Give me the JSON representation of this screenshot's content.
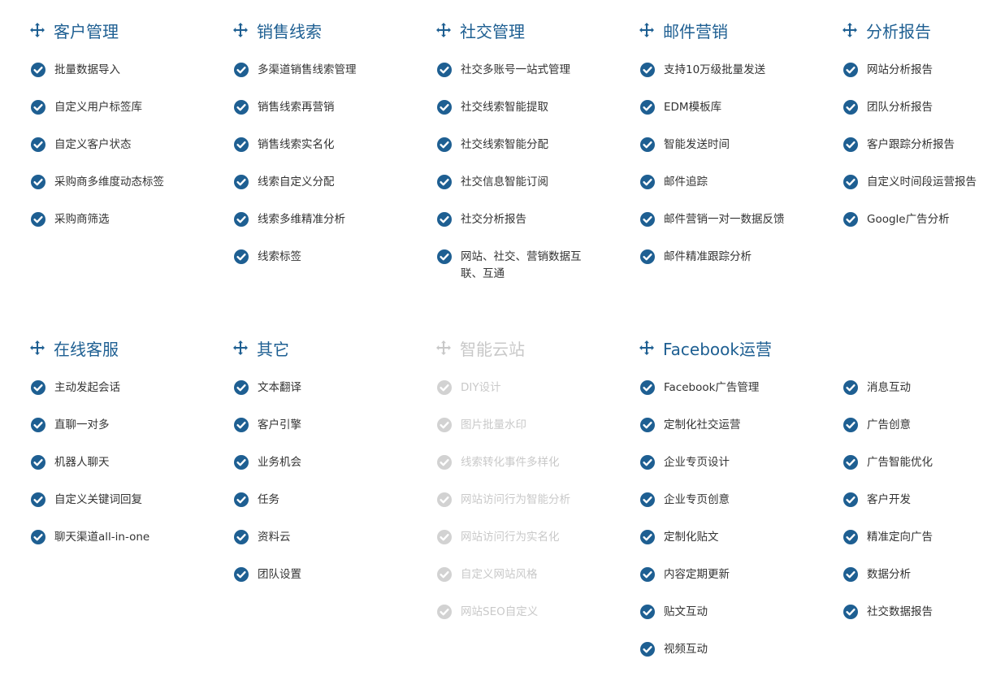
{
  "colors": {
    "accent": "#1e5f92",
    "text": "#333333",
    "muted": "#c8c8c8"
  },
  "rows": [
    {
      "columns": [
        {
          "title": "客户管理",
          "items": [
            "批量数据导入",
            "自定义用户标签库",
            "自定义客户状态",
            "采购商多维度动态标签",
            "采购商筛选"
          ]
        },
        {
          "title": "销售线索",
          "items": [
            "多渠道销售线索管理",
            "销售线索再营销",
            "销售线索实名化",
            "线索自定义分配",
            "线索多维精准分析",
            "线索标签"
          ]
        },
        {
          "title": "社交管理",
          "items": [
            "社交多账号一站式管理",
            "社交线索智能提取",
            "社交线索智能分配",
            "社交信息智能订阅",
            "社交分析报告",
            "网站、社交、营销数据互联、互通"
          ]
        },
        {
          "title": "邮件营销",
          "items": [
            "支持10万级批量发送",
            "EDM模板库",
            "智能发送时间",
            "邮件追踪",
            "邮件营销一对一数据反馈",
            "邮件精准跟踪分析"
          ]
        },
        {
          "title": "分析报告",
          "items": [
            "网站分析报告",
            "团队分析报告",
            "客户跟踪分析报告",
            "自定义时间段运营报告",
            "Google广告分析"
          ]
        }
      ]
    },
    {
      "columns": [
        {
          "title": "在线客服",
          "items": [
            "主动发起会话",
            "直聊一对多",
            "机器人聊天",
            "自定义关键词回复",
            "聊天渠道all-in-one"
          ]
        },
        {
          "title": "其它",
          "items": [
            "文本翻译",
            "客户引擎",
            "业务机会",
            "任务",
            "资料云",
            "团队设置"
          ]
        },
        {
          "title": "智能云站",
          "muted": true,
          "items": [
            "DIY设计",
            "图片批量水印",
            "线索转化事件多样化",
            "网站访问行为智能分析",
            "网站访问行为实名化",
            "自定义网站风格",
            "网站SEO自定义"
          ]
        },
        {
          "title": "Facebook运营",
          "items": [
            "Facebook广告管理",
            "定制化社交运营",
            "企业专页设计",
            "企业专页创意",
            "定制化贴文",
            "内容定期更新",
            "贴文互动",
            "视频互动"
          ]
        },
        {
          "title": "",
          "items": [
            "消息互动",
            "广告创意",
            "广告智能优化",
            "客户开发",
            "精准定向广告",
            "数据分析",
            "社交数据报告"
          ]
        }
      ]
    }
  ]
}
